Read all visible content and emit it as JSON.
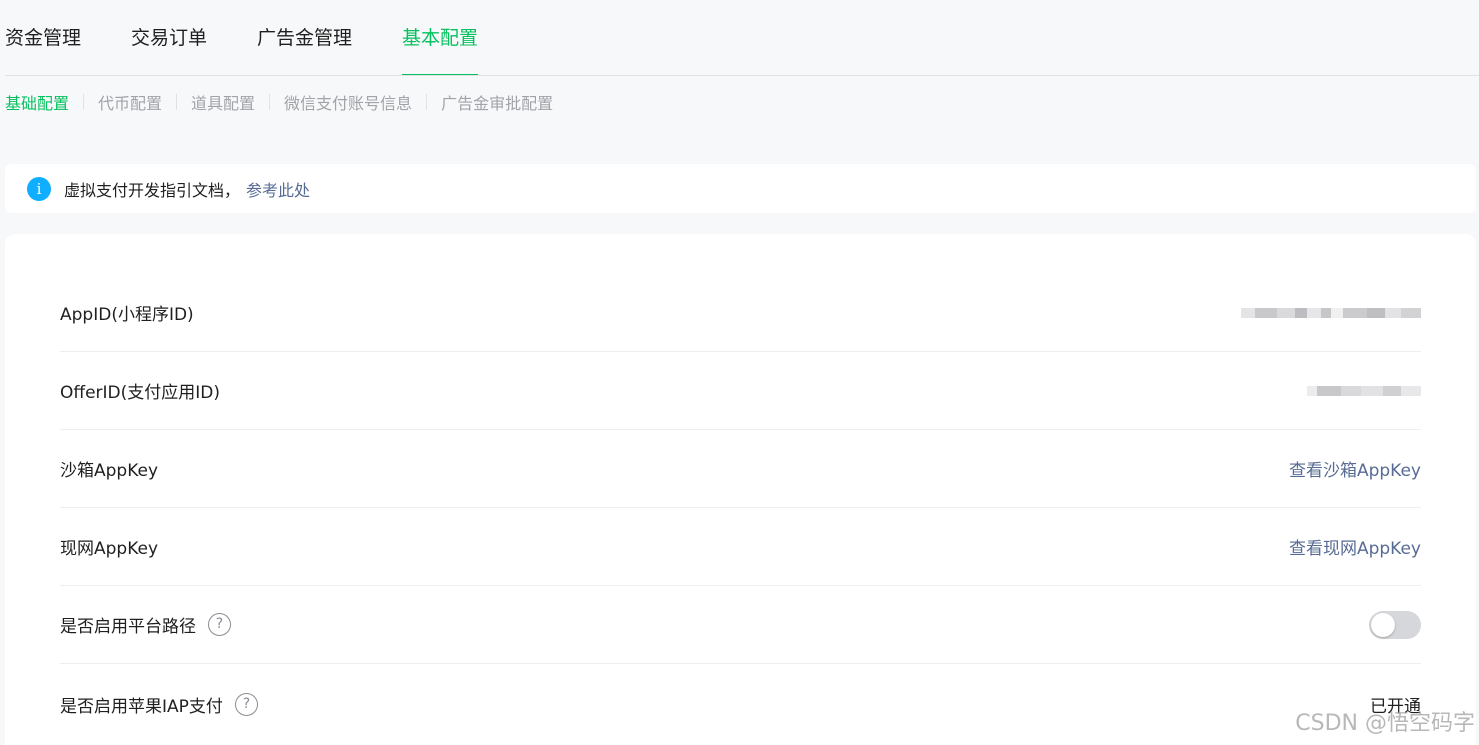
{
  "top_tabs": {
    "items": [
      "资金管理",
      "交易订单",
      "广告金管理",
      "基本配置"
    ],
    "active_index": 3
  },
  "sub_tabs": {
    "items": [
      "基础配置",
      "代币配置",
      "道具配置",
      "微信支付账号信息",
      "广告金审批配置"
    ],
    "active_index": 0
  },
  "notice": {
    "icon": "info-icon",
    "text": "虚拟支付开发指引文档，",
    "link": "参考此处"
  },
  "config": {
    "appid_label": "AppID(小程序ID)",
    "offerid_label": "OfferID(支付应用ID)",
    "sandbox_label": "沙箱AppKey",
    "sandbox_link": "查看沙箱AppKey",
    "live_label": "现网AppKey",
    "live_link": "查看现网AppKey",
    "platform_path_label": "是否启用平台路径",
    "platform_path_enabled": false,
    "iap_label": "是否启用苹果IAP支付",
    "iap_status": "已开通"
  },
  "colors": {
    "accent": "#07c160",
    "link": "#576b95",
    "info": "#10aeff"
  },
  "watermark": "CSDN @悟空码字"
}
